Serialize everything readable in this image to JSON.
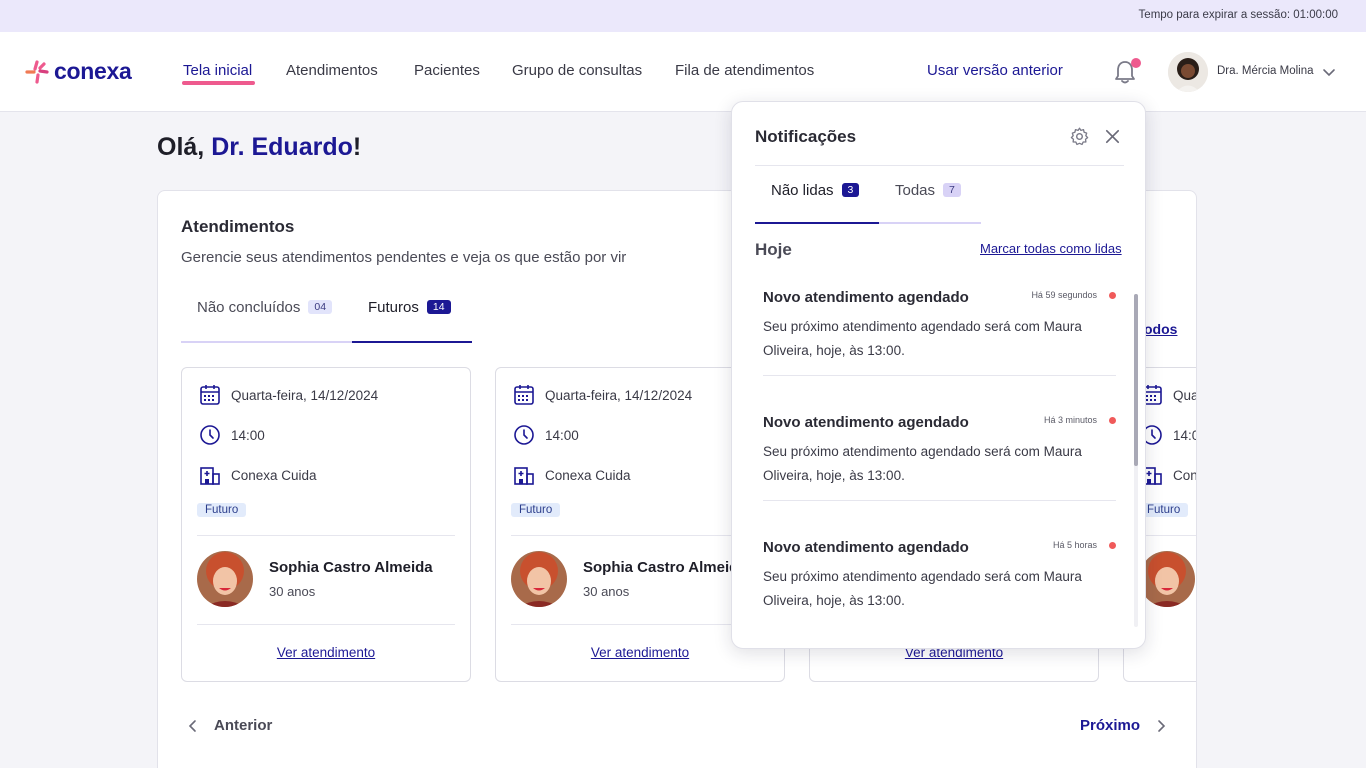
{
  "session": {
    "text": "Tempo para expirar a sessão: 01:00:00"
  },
  "header": {
    "logo_text": "conexa",
    "nav": [
      "Tela inicial",
      "Atendimentos",
      "Pacientes",
      "Grupo de consultas",
      "Fila de atendimentos"
    ],
    "prev_version": "Usar versão anterior",
    "user_name": "Dra. Mércia Molina",
    "icons": {
      "bell": "bell-icon",
      "chevron": "chevron-down-icon"
    }
  },
  "greeting": {
    "prefix": "Olá, ",
    "name": "Dr. Eduardo",
    "suffix": "!"
  },
  "panel": {
    "title": "Atendimentos",
    "subtitle": "Gerencie seus atendimentos pendentes e veja os que estão por vir",
    "tabs": [
      {
        "label": "Não concluídos",
        "count": "04"
      },
      {
        "label": "Futuros",
        "count": "14"
      }
    ],
    "see_all": "odos",
    "cards": [
      {
        "date": "Quarta-feira, 14/12/2024",
        "time": "14:00",
        "place": "Conexa Cuida",
        "status": "Futuro",
        "patient": "Sophia Castro Almeida",
        "age": "30 anos",
        "link": "Ver atendimento"
      },
      {
        "date": "Quarta-feira, 14/12/2024",
        "time": "14:00",
        "place": "Conexa Cuida",
        "status": "Futuro",
        "patient": "Sophia Castro Almeida",
        "age": "30 anos",
        "link": "Ver atendimento"
      },
      {
        "link": "Ver atendimento"
      },
      {
        "date": "Qua",
        "time": "14:0",
        "place": "Con",
        "status": "Futuro"
      }
    ],
    "pager": {
      "prev": "Anterior",
      "next": "Próximo"
    }
  },
  "notifications": {
    "title": "Notificações",
    "tabs": [
      {
        "label": "Não lidas",
        "count": "3"
      },
      {
        "label": "Todas",
        "count": "7"
      }
    ],
    "section": "Hoje",
    "mark_all": "Marcar todas como lidas",
    "items": [
      {
        "title": "Novo atendimento agendado",
        "time": "Há 59 segundos",
        "body": "Seu próximo atendimento agendado será com Maura Oliveira, hoje, às 13:00."
      },
      {
        "title": "Novo atendimento agendado",
        "time": "Há 3 minutos",
        "body": "Seu próximo atendimento agendado será com Maura Oliveira, hoje, às 13:00."
      },
      {
        "title": "Novo atendimento agendado",
        "time": "Há 5 horas",
        "body": "Seu próximo atendimento agendado será com Maura Oliveira, hoje, às 13:00."
      }
    ]
  },
  "colors": {
    "brand": "#1c1894",
    "accent": "#ee5a8e",
    "unread_dot": "#f05a5a"
  }
}
